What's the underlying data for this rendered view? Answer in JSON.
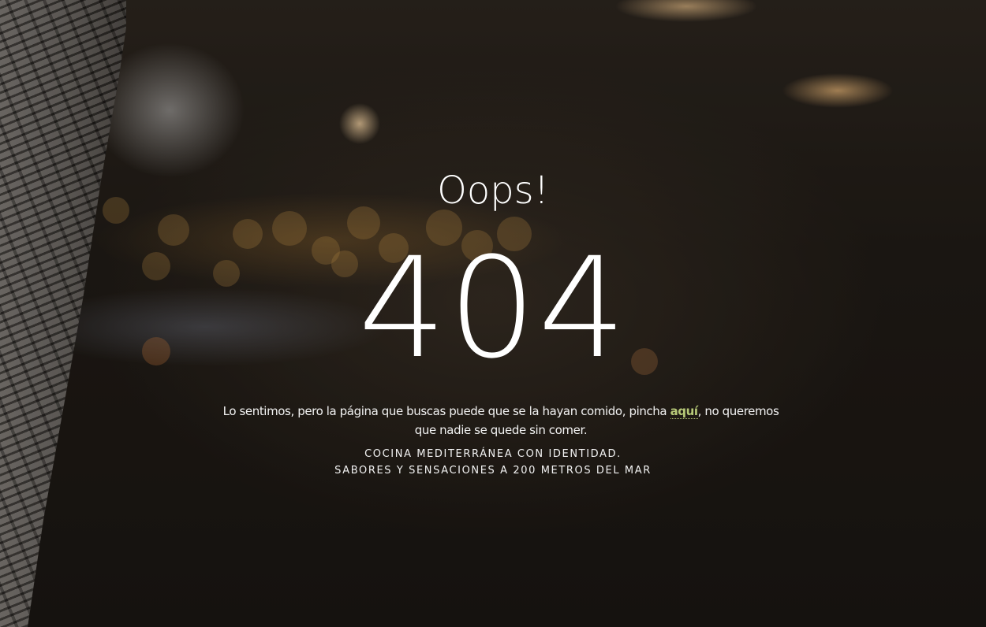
{
  "error": {
    "title": "Oops!",
    "code": "404"
  },
  "message": {
    "before": "Lo sentimos, pero la página que buscas puede que se la hayan comido,  pincha ",
    "link_label": "aquí",
    "after": ", no queremos que nadie se quede sin comer."
  },
  "tagline": {
    "line1": "COCINA MEDITERRÁNEA CON IDENTIDAD.",
    "line2": "SABORES Y SENSACIONES A 200 METROS DEL MAR"
  },
  "colors": {
    "link": "#b7c978",
    "text": "#ffffff"
  }
}
